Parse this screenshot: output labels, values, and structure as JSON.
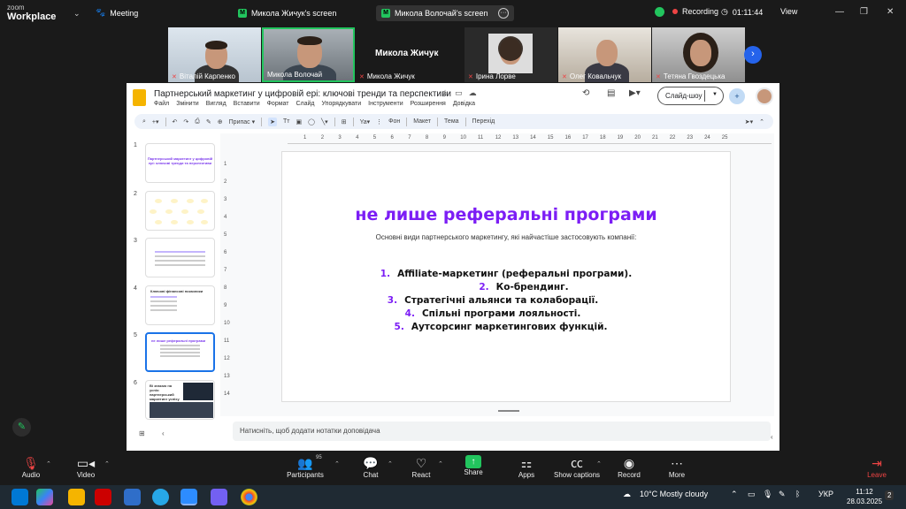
{
  "zoom": {
    "logo_top": "zoom",
    "logo_bottom": "Workplace",
    "meeting_label": "Meeting",
    "tabs": [
      "Микола Жичук's screen",
      "Микола Волочай's screen"
    ],
    "recording_label": "Recording",
    "timer": "01:11:44",
    "view_label": "View"
  },
  "participants": [
    {
      "name": "Віталій Карпенко"
    },
    {
      "name": "Микола Волочай"
    },
    {
      "name": "Микола Жичук",
      "display_name": "Микола Жичук"
    },
    {
      "name": "Ірина Лорве"
    },
    {
      "name": "Олег Ковальчук"
    },
    {
      "name": "Тетяна Гвоздецька"
    }
  ],
  "slides_app": {
    "doc_title": "Партнерський маркетинг у цифровій ері: ключові тренди та перспективи",
    "menus": [
      "Файл",
      "Змінити",
      "Вигляд",
      "Вставити",
      "Формат",
      "Слайд",
      "Упорядкувати",
      "Інструменти",
      "Розширення",
      "Довідка"
    ],
    "slideshow_label": "Слайд-шоу",
    "toolbar": {
      "fit": "Припас",
      "background": "Фон",
      "layout": "Макет",
      "theme": "Тема",
      "transition": "Перехід"
    },
    "slide_numbers": [
      "1",
      "2",
      "3",
      "4",
      "5",
      "6"
    ],
    "thumb1_title": "Партнерський маркетинг у цифровій ері: ключові тренди та перспективи",
    "thumb4_title": "Ключові фінансові показники",
    "thumb5_title": "не лише реферальні програми",
    "thumb6_title": "Ві знаємо на успіх: партнерський маркетинг успіху",
    "ruler_h": [
      "1",
      "2",
      "3",
      "4",
      "5",
      "6",
      "7",
      "8",
      "9",
      "10",
      "11",
      "12",
      "13",
      "14",
      "15",
      "16",
      "17",
      "18",
      "19",
      "20",
      "21",
      "22",
      "23",
      "24",
      "25"
    ],
    "ruler_v": [
      "1",
      "2",
      "3",
      "4",
      "5",
      "6",
      "7",
      "8",
      "9",
      "10",
      "11",
      "12",
      "13",
      "14"
    ],
    "notes_placeholder": "Натисніть, щоб додати нотатки доповідача"
  },
  "slide": {
    "title": "не лише реферальні програми",
    "subtitle": "Основні види партнерського маркетингу, які найчастіше застосовують компанії:",
    "items": [
      {
        "n": "1.",
        "text": "Affiliate-маркетинг (реферальні програми)."
      },
      {
        "n": "2.",
        "text": "Ко-брендинг."
      },
      {
        "n": "3.",
        "text": "Стратегічні альянси та колаборації."
      },
      {
        "n": "4.",
        "text": "Спільні програми лояльності."
      },
      {
        "n": "5.",
        "text": "Аутсорсинг маркетингових функцій."
      }
    ]
  },
  "controls": {
    "audio": "Audio",
    "video": "Video",
    "participants": "Participants",
    "participants_count": "95",
    "chat": "Chat",
    "react": "React",
    "share": "Share",
    "apps": "Apps",
    "captions": "Show captions",
    "record": "Record",
    "more": "More",
    "leave": "Leave"
  },
  "taskbar": {
    "weather": "10°C  Mostly cloudy",
    "lang": "УКР",
    "time": "11:12",
    "date": "28.03.2025",
    "notif_count": "2"
  },
  "colors": {
    "accent_purple": "#7c1ef5",
    "zoom_green": "#22c55e",
    "record_red": "#ef4444"
  }
}
